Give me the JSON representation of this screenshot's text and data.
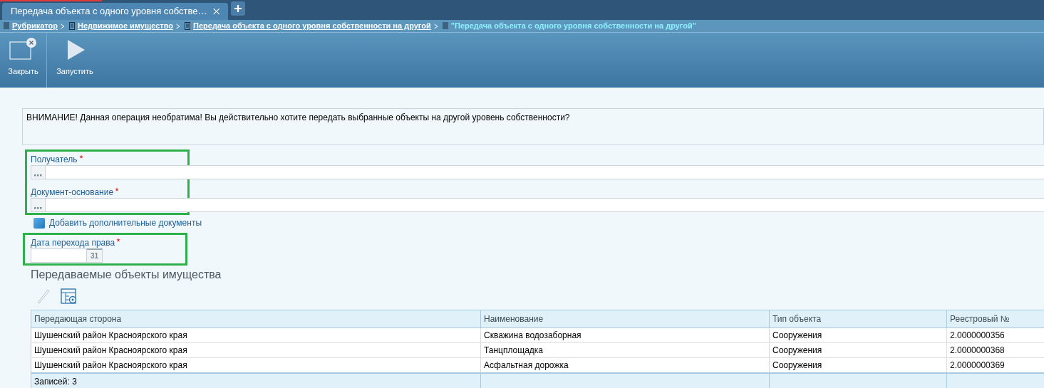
{
  "tabs": [
    {
      "label": "Передача объекта с одного уровня собстве…",
      "selected": true
    }
  ],
  "breadcrumb": [
    {
      "kind": "link",
      "label": "Рубрикатор"
    },
    {
      "kind": "link",
      "label": "Недвижимое имущество"
    },
    {
      "kind": "link",
      "label": "Передача объекта с одного уровня собственности на другой"
    },
    {
      "kind": "current",
      "label": "\"Передача объекта с одного уровня собственности на другой\""
    }
  ],
  "toolbar": [
    {
      "kind": "close",
      "label": "Закрыть"
    },
    {
      "kind": "run",
      "label": "Запустить"
    }
  ],
  "warning": "ВНИМАНИЕ! Данная операция необратима! Вы действительно хотите передать выбранные объекты на другой уровень собственности?",
  "form": [
    {
      "kind": "group",
      "fields": [
        {
          "kind": "lookup",
          "label": "Получатель",
          "required": true
        },
        {
          "kind": "lookup",
          "label": "Документ-основание",
          "required": true
        }
      ]
    },
    {
      "kind": "link",
      "label": "Добавить дополнительные документы"
    },
    {
      "kind": "group",
      "fields": [
        {
          "kind": "date",
          "label": "Дата перехода права",
          "required": true,
          "button": "31"
        }
      ]
    }
  ],
  "section_title": "Передаваемые объекты имущества",
  "table": {
    "columns": [
      "Передающая сторона",
      "Наименование",
      "Тип объекта",
      "Реестровый №"
    ],
    "rows": [
      [
        "Шушенский район Красноярского края",
        "Скважина водозаборная",
        "Сооружения",
        "2.0000000356"
      ],
      [
        "Шушенский район Красноярского края",
        "Танцплощадка",
        "Сооружения",
        "2.0000000368"
      ],
      [
        "Шушенский район Красноярского края",
        "Асфальтная дорожка",
        "Сооружения",
        "2.0000000369"
      ]
    ],
    "footer": "Записей: 3"
  }
}
